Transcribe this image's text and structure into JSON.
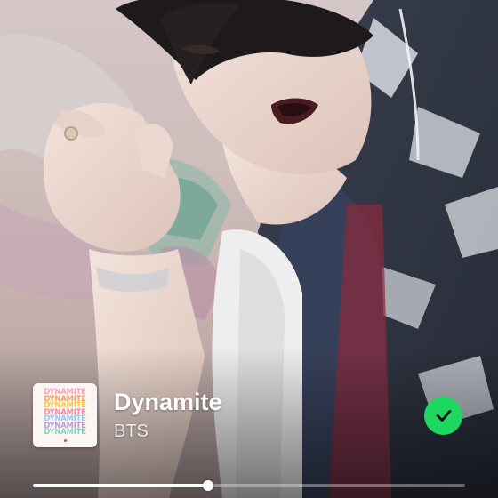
{
  "track": {
    "title": "Dynamite",
    "artist": "BTS",
    "saved": true
  },
  "album_art": {
    "text": "DYNAMITE",
    "line_colors": [
      "#f2a3c0",
      "#f4a25b",
      "#f6c84c",
      "#f48aa2",
      "#9cc3ea",
      "#b99ad6",
      "#8fd0b9"
    ]
  },
  "playback": {
    "progress": 0.405
  },
  "colors": {
    "accent": "#1ed760",
    "text_primary": "#ffffff",
    "text_secondary": "#e9e9e9"
  },
  "icons": {
    "saved": "check-circle-icon"
  }
}
